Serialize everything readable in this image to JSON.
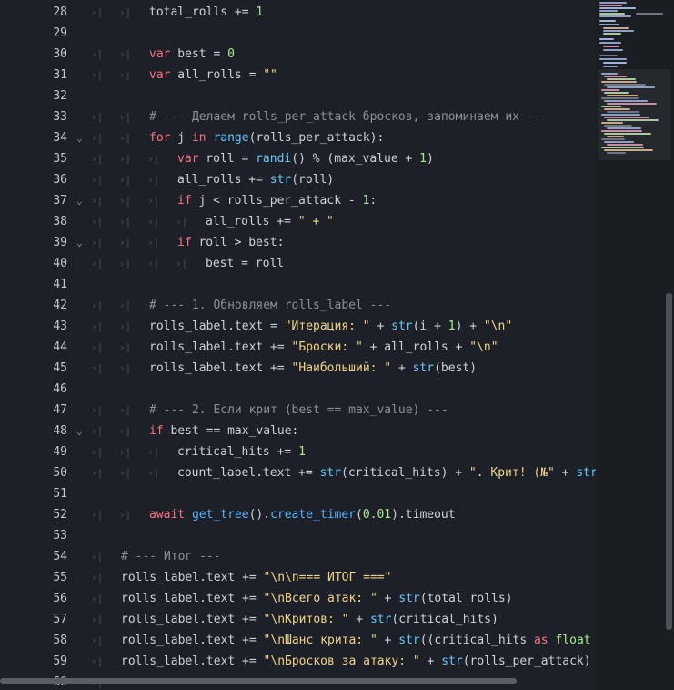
{
  "tab_marker": "›|",
  "fold_marker": "⌄",
  "lines": [
    {
      "n": "28",
      "tabs": 2,
      "fold": false,
      "tokens": [
        [
          "",
          "total_rolls += "
        ],
        [
          "num",
          "1"
        ]
      ]
    },
    {
      "n": "29",
      "tabs": 0,
      "fold": false,
      "tokens": []
    },
    {
      "n": "30",
      "tabs": 2,
      "fold": false,
      "tokens": [
        [
          "kw",
          "var"
        ],
        [
          "",
          " best = "
        ],
        [
          "num",
          "0"
        ]
      ]
    },
    {
      "n": "31",
      "tabs": 2,
      "fold": false,
      "tokens": [
        [
          "kw",
          "var"
        ],
        [
          "",
          " all_rolls = "
        ],
        [
          "str",
          "\"\""
        ]
      ]
    },
    {
      "n": "32",
      "tabs": 0,
      "fold": false,
      "tokens": []
    },
    {
      "n": "33",
      "tabs": 2,
      "fold": false,
      "tokens": [
        [
          "cm",
          "# --- Делаем rolls_per_attack бросков, запоминаем их ---"
        ]
      ]
    },
    {
      "n": "34",
      "tabs": 2,
      "fold": true,
      "tokens": [
        [
          "kw",
          "for"
        ],
        [
          "",
          " j "
        ],
        [
          "kw",
          "in"
        ],
        [
          "",
          " "
        ],
        [
          "fn",
          "range"
        ],
        [
          "",
          "(rolls_per_attack):"
        ]
      ]
    },
    {
      "n": "35",
      "tabs": 3,
      "fold": false,
      "tokens": [
        [
          "kw",
          "var"
        ],
        [
          "",
          " roll = "
        ],
        [
          "fn",
          "randi"
        ],
        [
          "",
          "() % (max_value + "
        ],
        [
          "num",
          "1"
        ],
        [
          "",
          ")"
        ]
      ]
    },
    {
      "n": "36",
      "tabs": 3,
      "fold": false,
      "tokens": [
        [
          "",
          "all_rolls += "
        ],
        [
          "fn",
          "str"
        ],
        [
          "",
          "(roll)"
        ]
      ]
    },
    {
      "n": "37",
      "tabs": 3,
      "fold": true,
      "tokens": [
        [
          "kw",
          "if"
        ],
        [
          "",
          " j < rolls_per_attack - "
        ],
        [
          "num",
          "1"
        ],
        [
          "",
          ":"
        ]
      ]
    },
    {
      "n": "38",
      "tabs": 4,
      "fold": false,
      "tokens": [
        [
          "",
          "all_rolls += "
        ],
        [
          "str",
          "\" + \""
        ]
      ]
    },
    {
      "n": "39",
      "tabs": 3,
      "fold": true,
      "tokens": [
        [
          "kw",
          "if"
        ],
        [
          "",
          " roll > best:"
        ]
      ]
    },
    {
      "n": "40",
      "tabs": 4,
      "fold": false,
      "tokens": [
        [
          "",
          "best = roll"
        ]
      ]
    },
    {
      "n": "41",
      "tabs": 0,
      "fold": false,
      "tokens": []
    },
    {
      "n": "42",
      "tabs": 2,
      "fold": false,
      "tokens": [
        [
          "cm",
          "# --- 1. Обновляем rolls_label ---"
        ]
      ]
    },
    {
      "n": "43",
      "tabs": 2,
      "fold": false,
      "tokens": [
        [
          "",
          "rolls_label.text = "
        ],
        [
          "str",
          "\"Итерация: \""
        ],
        [
          "",
          " + "
        ],
        [
          "fn",
          "str"
        ],
        [
          "",
          "(i + "
        ],
        [
          "num",
          "1"
        ],
        [
          "",
          ") + "
        ],
        [
          "str",
          "\"\\n\""
        ]
      ]
    },
    {
      "n": "44",
      "tabs": 2,
      "fold": false,
      "tokens": [
        [
          "",
          "rolls_label.text += "
        ],
        [
          "str",
          "\"Броски: \""
        ],
        [
          "",
          " + all_rolls + "
        ],
        [
          "str",
          "\"\\n\""
        ]
      ]
    },
    {
      "n": "45",
      "tabs": 2,
      "fold": false,
      "tokens": [
        [
          "",
          "rolls_label.text += "
        ],
        [
          "str",
          "\"Наибольший: \""
        ],
        [
          "",
          " + "
        ],
        [
          "fn",
          "str"
        ],
        [
          "",
          "(best)"
        ]
      ]
    },
    {
      "n": "46",
      "tabs": 0,
      "fold": false,
      "tokens": []
    },
    {
      "n": "47",
      "tabs": 2,
      "fold": false,
      "tokens": [
        [
          "cm",
          "# --- 2. Если крит (best == max_value) ---"
        ]
      ]
    },
    {
      "n": "48",
      "tabs": 2,
      "fold": true,
      "tokens": [
        [
          "kw",
          "if"
        ],
        [
          "",
          " best == max_value:"
        ]
      ]
    },
    {
      "n": "49",
      "tabs": 3,
      "fold": false,
      "tokens": [
        [
          "",
          "critical_hits += "
        ],
        [
          "num",
          "1"
        ]
      ]
    },
    {
      "n": "50",
      "tabs": 3,
      "fold": false,
      "tokens": [
        [
          "",
          "count_label.text += "
        ],
        [
          "fn",
          "str"
        ],
        [
          "",
          "(critical_hits) + "
        ],
        [
          "str",
          "\". Крит! (№\""
        ],
        [
          "",
          " + "
        ],
        [
          "fn",
          "str"
        ]
      ]
    },
    {
      "n": "51",
      "tabs": 0,
      "fold": false,
      "tokens": []
    },
    {
      "n": "52",
      "tabs": 2,
      "fold": false,
      "tokens": [
        [
          "kw",
          "await"
        ],
        [
          "",
          " "
        ],
        [
          "fnu",
          "get_tree"
        ],
        [
          "",
          "()."
        ],
        [
          "fnu",
          "create_timer"
        ],
        [
          "",
          "("
        ],
        [
          "num",
          "0.01"
        ],
        [
          "",
          ").timeout"
        ]
      ]
    },
    {
      "n": "53",
      "tabs": 0,
      "fold": false,
      "tokens": []
    },
    {
      "n": "54",
      "tabs": 1,
      "fold": false,
      "tokens": [
        [
          "cm",
          "# --- Итог ---"
        ]
      ]
    },
    {
      "n": "55",
      "tabs": 1,
      "fold": false,
      "tokens": [
        [
          "",
          "rolls_label.text += "
        ],
        [
          "str",
          "\"\\n\\n=== ИТОГ ===\""
        ]
      ]
    },
    {
      "n": "56",
      "tabs": 1,
      "fold": false,
      "tokens": [
        [
          "",
          "rolls_label.text += "
        ],
        [
          "str",
          "\"\\nВсего атак: \""
        ],
        [
          "",
          " + "
        ],
        [
          "fn",
          "str"
        ],
        [
          "",
          "(total_rolls)"
        ]
      ]
    },
    {
      "n": "57",
      "tabs": 1,
      "fold": false,
      "tokens": [
        [
          "",
          "rolls_label.text += "
        ],
        [
          "str",
          "\"\\nКритов: \""
        ],
        [
          "",
          " + "
        ],
        [
          "fn",
          "str"
        ],
        [
          "",
          "(critical_hits)"
        ]
      ]
    },
    {
      "n": "58",
      "tabs": 1,
      "fold": false,
      "tokens": [
        [
          "",
          "rolls_label.text += "
        ],
        [
          "str",
          "\"\\nШанс крита: \""
        ],
        [
          "",
          " + "
        ],
        [
          "fn",
          "str"
        ],
        [
          "",
          "((critical_hits "
        ],
        [
          "kw",
          "as"
        ],
        [
          "",
          " "
        ],
        [
          "num",
          "float"
        ]
      ]
    },
    {
      "n": "59",
      "tabs": 1,
      "fold": false,
      "tokens": [
        [
          "",
          "rolls_label.text += "
        ],
        [
          "str",
          "\"\\nБросков за атаку: \""
        ],
        [
          "",
          " + "
        ],
        [
          "fn",
          "str"
        ],
        [
          "",
          "(rolls_per_attack)"
        ]
      ]
    },
    {
      "n": "60",
      "tabs": 1,
      "fold": false,
      "tokens": []
    }
  ],
  "colors": {
    "background": "#1d2026",
    "keyword": "#ff7085",
    "comment": "#8b9099",
    "number": "#a6ee8e",
    "string": "#f1d48a",
    "function": "#66c7ff"
  }
}
